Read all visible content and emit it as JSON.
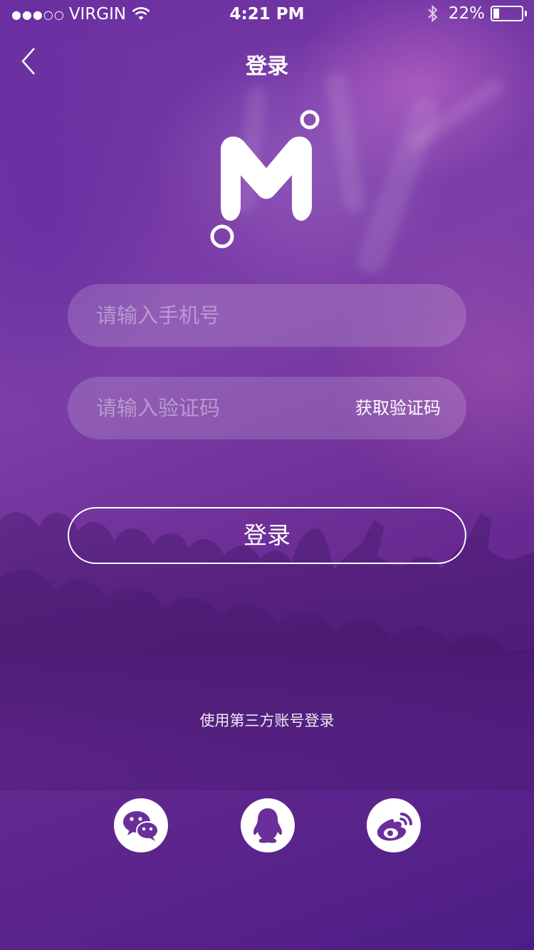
{
  "status_bar": {
    "signal": "●●●○○",
    "carrier": "VIRGIN",
    "time": "4:21 PM",
    "battery_percent": "22%",
    "battery_level": 0.22,
    "icons": [
      "signal-dots-icon",
      "wifi-icon",
      "bluetooth-icon",
      "battery-icon"
    ]
  },
  "nav": {
    "title": "登录",
    "back_icon": "chevron-left-icon"
  },
  "logo": {
    "icon": "m-logo-icon"
  },
  "form": {
    "phone_placeholder": "请输入手机号",
    "phone_value": "",
    "code_placeholder": "请输入验证码",
    "code_value": "",
    "get_code_label": "获取验证码",
    "login_label": "登录"
  },
  "third_party": {
    "label": "使用第三方账号登录",
    "providers": [
      {
        "name": "wechat",
        "icon": "wechat-icon"
      },
      {
        "name": "qq",
        "icon": "qq-icon"
      },
      {
        "name": "weibo",
        "icon": "weibo-icon"
      }
    ]
  },
  "colors": {
    "background_top": "#7d3fa8",
    "background_bottom": "#4c1e85",
    "icon_purple": "#6a2f9a",
    "text": "#ffffff"
  }
}
